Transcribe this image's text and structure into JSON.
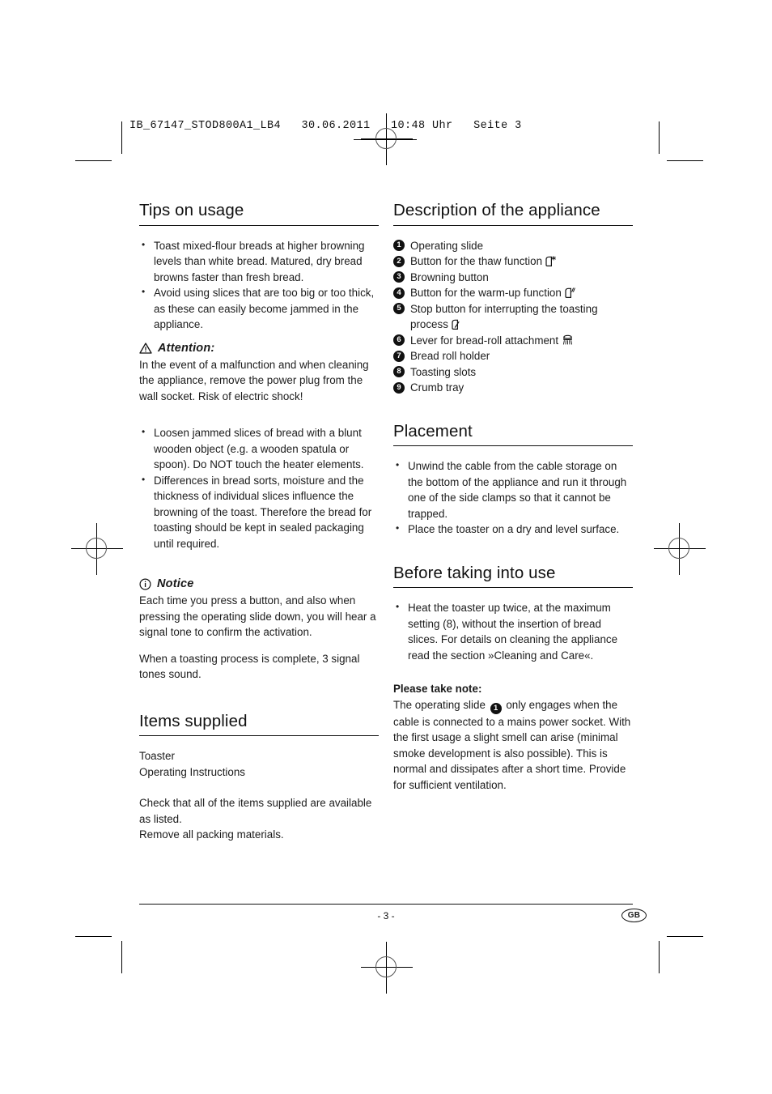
{
  "prepress": {
    "slug": "IB_67147_STOD800A1_LB4   30.06.2011   10:48 Uhr   Seite 3"
  },
  "left_column": {
    "tips": {
      "heading": "Tips on usage",
      "bullets": [
        "Toast mixed-flour breads at higher browning levels than white bread. Matured, dry bread browns faster than fresh bread.",
        "Avoid using slices that are too big or too thick, as these can easily become jammed in the appliance."
      ]
    },
    "attention": {
      "icon": "warning-triangle-icon",
      "title": "Attention:",
      "body": "In the event of a malfunction and when cleaning the appliance, remove the power plug from the wall socket. Risk of electric shock!"
    },
    "tips_more": {
      "bullets": [
        "Loosen jammed slices of bread with a blunt wooden object (e.g. a wooden spatula or spoon). Do NOT touch the heater elements.",
        "Differences in bread sorts, moisture and the thickness of individual slices influence the browning of the toast. Therefore the bread for toasting should be kept in sealed packaging until required."
      ]
    },
    "notice": {
      "icon": "info-circle-icon",
      "title": "Notice",
      "paragraphs": [
        "Each time you press a button, and also when pressing the operating slide down, you will hear a signal tone to confirm the activation.",
        "When a toasting process is complete, 3 signal tones sound."
      ]
    },
    "items_supplied": {
      "heading": "Items supplied",
      "list": [
        "Toaster",
        "Operating Instructions"
      ],
      "paragraphs": [
        "Check that all of the items supplied are available as listed.",
        "Remove all packing materials."
      ]
    }
  },
  "right_column": {
    "description": {
      "heading": "Description of the appliance",
      "items": [
        {
          "num": "1",
          "label": "Operating slide",
          "icon": ""
        },
        {
          "num": "2",
          "label": "Button for the thaw function",
          "icon": "bread-slice-snowflake-icon"
        },
        {
          "num": "3",
          "label": "Browning button",
          "icon": ""
        },
        {
          "num": "4",
          "label": "Button for the warm-up function",
          "icon": "bread-slice-heat-icon"
        },
        {
          "num": "5",
          "label": "Stop button for interrupting the toasting process",
          "icon": "bread-slice-stop-icon"
        },
        {
          "num": "6",
          "label": "Lever for bread-roll attachment",
          "icon": "bread-roll-rack-icon"
        },
        {
          "num": "7",
          "label": "Bread roll holder",
          "icon": ""
        },
        {
          "num": "8",
          "label": "Toasting slots",
          "icon": ""
        },
        {
          "num": "9",
          "label": "Crumb tray",
          "icon": ""
        }
      ]
    },
    "placement": {
      "heading": "Placement",
      "bullets": [
        "Unwind the cable from the cable storage on the bottom of the appliance and run it through one of the side clamps so that it cannot be trapped.",
        "Place the toaster on a dry and level surface."
      ]
    },
    "before_use": {
      "heading": "Before taking into use",
      "bullets": [
        "Heat the toaster up twice, at the maximum setting (8), without the insertion of bread slices. For details on cleaning the appliance read the section »Cleaning and Care«."
      ],
      "note_title": "Please take note:",
      "note_before": "The operating slide",
      "note_marker": "1",
      "note_after": "only engages when the cable is connected to a mains power socket. With the first usage a slight smell can arise (minimal smoke development is also possible). This is normal and dissipates after a short time. Provide for sufficient ventilation."
    }
  },
  "footer": {
    "page_number": "- 3 -",
    "language_badge": "GB"
  },
  "colors": {
    "text": "#1a1a1a",
    "rule": "#111111",
    "marker_fill": "#111111"
  }
}
